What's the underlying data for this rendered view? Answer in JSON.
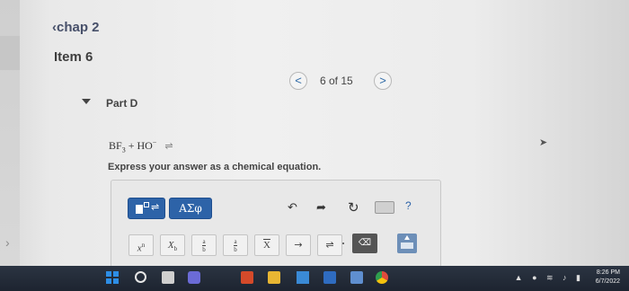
{
  "header": {
    "back_link": "chap 2",
    "item_title": "Item 6"
  },
  "navigation": {
    "prev": "<",
    "count": "6 of 15",
    "next": ">"
  },
  "part": {
    "label": "Part D"
  },
  "question": {
    "formula_bf": "BF",
    "formula_sub": "3",
    "formula_plus": "+ HO",
    "formula_sup": "−",
    "formula_arrow": "⇌",
    "instruction": "Express your answer as a chemical equation."
  },
  "editor": {
    "greek_label": "ΑΣφ",
    "help_label": "?",
    "undo_glyph": "↶",
    "redo_glyph": "➦",
    "reset_glyph": "↻",
    "symbols": {
      "superscript": "x",
      "superscript_mark": "n",
      "subscript": "X",
      "subscript_mark": "b",
      "frac_a": "a",
      "frac_b": "b",
      "inv_frac_a": "a",
      "inv_frac_b": "b",
      "xbar": "X",
      "arrow": "→",
      "equilibrium": "⇌",
      "dot": "•"
    }
  },
  "taskbar": {
    "clock_time": "8:26 PM",
    "clock_date": "6/7/2022"
  }
}
